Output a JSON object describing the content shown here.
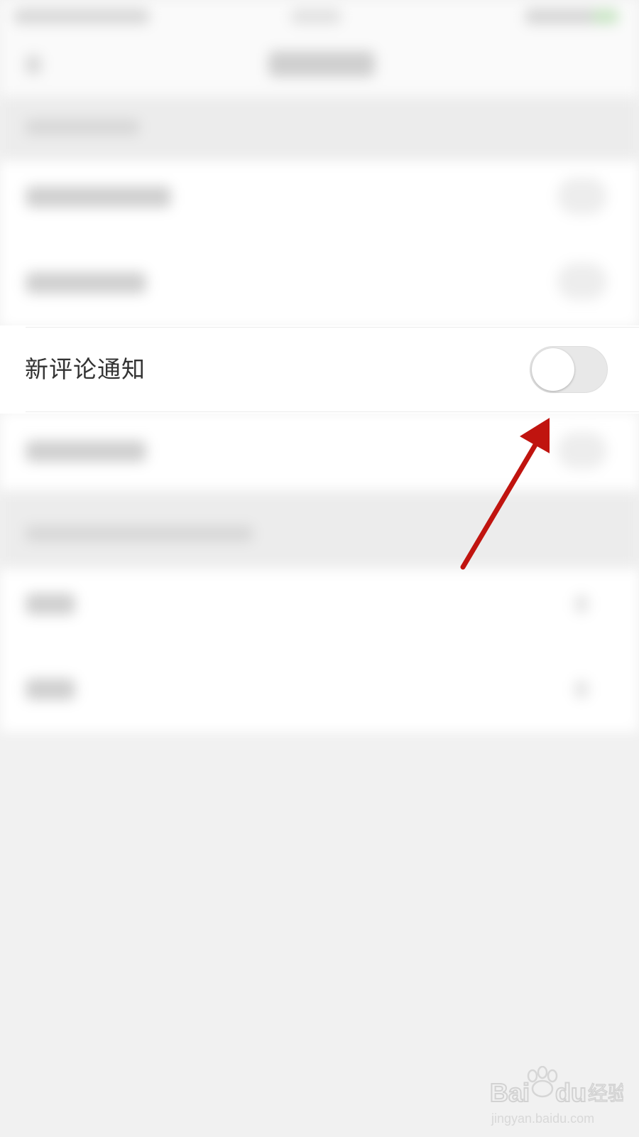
{
  "settings": {
    "new_comment_notification": {
      "label": "新评论通知",
      "toggle_on": false
    }
  },
  "annotation": {
    "arrow_color": "#c0140f",
    "points_to": "toggle-switch"
  },
  "watermark": {
    "brand_left": "Bai",
    "brand_right": "du",
    "brand_cn": "经验",
    "url": "jingyan.baidu.com",
    "icon": "paw-icon"
  },
  "colors": {
    "background": "#f1f1f1",
    "row_background": "#ffffff",
    "label_text": "#333333",
    "toggle_track_off": "#e8e8e8",
    "toggle_knob": "#ffffff"
  }
}
